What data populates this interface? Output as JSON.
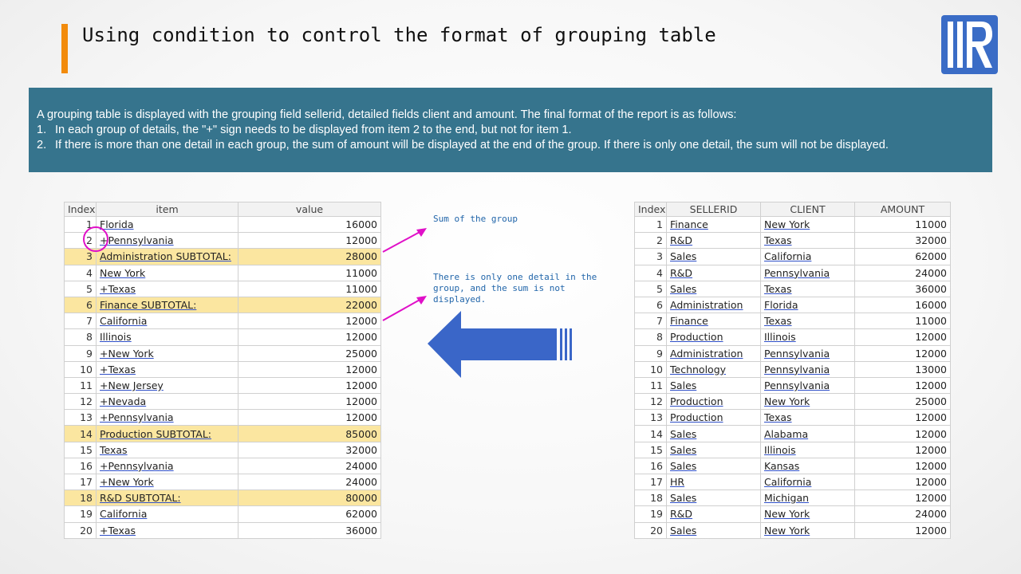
{
  "slide": {
    "title": "Using condition to control the format of grouping table",
    "description": {
      "intro": "A grouping table is displayed with the grouping field sellerid, detailed fields client and amount. The final format of the report is as follows:",
      "points": [
        {
          "num": "1.",
          "text": "In each group of details, the \"+\" sign needs to be displayed from item 2 to the end, but not for item 1."
        },
        {
          "num": "2.",
          "text": "If there is more than one detail in each group, the sum of amount will be displayed at the end of the group. If there is only one detail, the sum will not be displayed."
        }
      ]
    },
    "annotations": {
      "sum_note": "Sum of the group",
      "one_detail_note": "There is only one detail in the group, and the sum is not displayed."
    },
    "colors": {
      "accent": "#f28b0c",
      "banner": "#36748d",
      "subtotal_highlight": "#fbe6a0",
      "annotation_magenta": "#e010c8",
      "arrow_blue": "#3a66c8",
      "logo_blue": "#3a6cc6"
    }
  },
  "left_table": {
    "headers": [
      "Index",
      "item",
      "value"
    ],
    "rows": [
      {
        "index": "1",
        "item": "Florida",
        "value": "16000",
        "subtotal": false
      },
      {
        "index": "2",
        "item": "+Pennsylvania",
        "value": "12000",
        "subtotal": false
      },
      {
        "index": "3",
        "item": "Administration SUBTOTAL:",
        "value": "28000",
        "subtotal": true
      },
      {
        "index": "4",
        "item": "New York",
        "value": "11000",
        "subtotal": false
      },
      {
        "index": "5",
        "item": "+Texas",
        "value": "11000",
        "subtotal": false
      },
      {
        "index": "6",
        "item": "Finance SUBTOTAL:",
        "value": "22000",
        "subtotal": true
      },
      {
        "index": "7",
        "item": "California",
        "value": "12000",
        "subtotal": false
      },
      {
        "index": "8",
        "item": "Illinois",
        "value": "12000",
        "subtotal": false
      },
      {
        "index": "9",
        "item": "+New York",
        "value": "25000",
        "subtotal": false
      },
      {
        "index": "10",
        "item": "+Texas",
        "value": "12000",
        "subtotal": false
      },
      {
        "index": "11",
        "item": "+New Jersey",
        "value": "12000",
        "subtotal": false
      },
      {
        "index": "12",
        "item": "+Nevada",
        "value": "12000",
        "subtotal": false
      },
      {
        "index": "13",
        "item": "+Pennsylvania",
        "value": "12000",
        "subtotal": false
      },
      {
        "index": "14",
        "item": "Production SUBTOTAL:",
        "value": "85000",
        "subtotal": true
      },
      {
        "index": "15",
        "item": "Texas",
        "value": "32000",
        "subtotal": false
      },
      {
        "index": "16",
        "item": "+Pennsylvania",
        "value": "24000",
        "subtotal": false
      },
      {
        "index": "17",
        "item": "+New York",
        "value": "24000",
        "subtotal": false
      },
      {
        "index": "18",
        "item": "R&D SUBTOTAL:",
        "value": "80000",
        "subtotal": true
      },
      {
        "index": "19",
        "item": "California",
        "value": "62000",
        "subtotal": false
      },
      {
        "index": "20",
        "item": "+Texas",
        "value": "36000",
        "subtotal": false
      }
    ]
  },
  "right_table": {
    "headers": [
      "Index",
      "SELLERID",
      "CLIENT",
      "AMOUNT"
    ],
    "rows": [
      {
        "index": "1",
        "sellerid": "Finance",
        "client": "New York",
        "amount": "11000"
      },
      {
        "index": "2",
        "sellerid": "R&D",
        "client": "Texas",
        "amount": "32000"
      },
      {
        "index": "3",
        "sellerid": "Sales",
        "client": "California",
        "amount": "62000"
      },
      {
        "index": "4",
        "sellerid": "R&D",
        "client": "Pennsylvania",
        "amount": "24000"
      },
      {
        "index": "5",
        "sellerid": "Sales",
        "client": "Texas",
        "amount": "36000"
      },
      {
        "index": "6",
        "sellerid": "Administration",
        "client": "Florida",
        "amount": "16000"
      },
      {
        "index": "7",
        "sellerid": "Finance",
        "client": "Texas",
        "amount": "11000"
      },
      {
        "index": "8",
        "sellerid": "Production",
        "client": "Illinois",
        "amount": "12000"
      },
      {
        "index": "9",
        "sellerid": "Administration",
        "client": "Pennsylvania",
        "amount": "12000"
      },
      {
        "index": "10",
        "sellerid": "Technology",
        "client": "Pennsylvania",
        "amount": "13000"
      },
      {
        "index": "11",
        "sellerid": "Sales",
        "client": "Pennsylvania",
        "amount": "12000"
      },
      {
        "index": "12",
        "sellerid": "Production",
        "client": "New York",
        "amount": "25000"
      },
      {
        "index": "13",
        "sellerid": "Production",
        "client": "Texas",
        "amount": "12000"
      },
      {
        "index": "14",
        "sellerid": "Sales",
        "client": "Alabama",
        "amount": "12000"
      },
      {
        "index": "15",
        "sellerid": "Sales",
        "client": "Illinois",
        "amount": "12000"
      },
      {
        "index": "16",
        "sellerid": "Sales",
        "client": "Kansas",
        "amount": "12000"
      },
      {
        "index": "17",
        "sellerid": "HR",
        "client": "California",
        "amount": "12000"
      },
      {
        "index": "18",
        "sellerid": "Sales",
        "client": "Michigan",
        "amount": "12000"
      },
      {
        "index": "19",
        "sellerid": "R&D",
        "client": "New York",
        "amount": "24000"
      },
      {
        "index": "20",
        "sellerid": "Sales",
        "client": "New York",
        "amount": "12000"
      }
    ]
  }
}
